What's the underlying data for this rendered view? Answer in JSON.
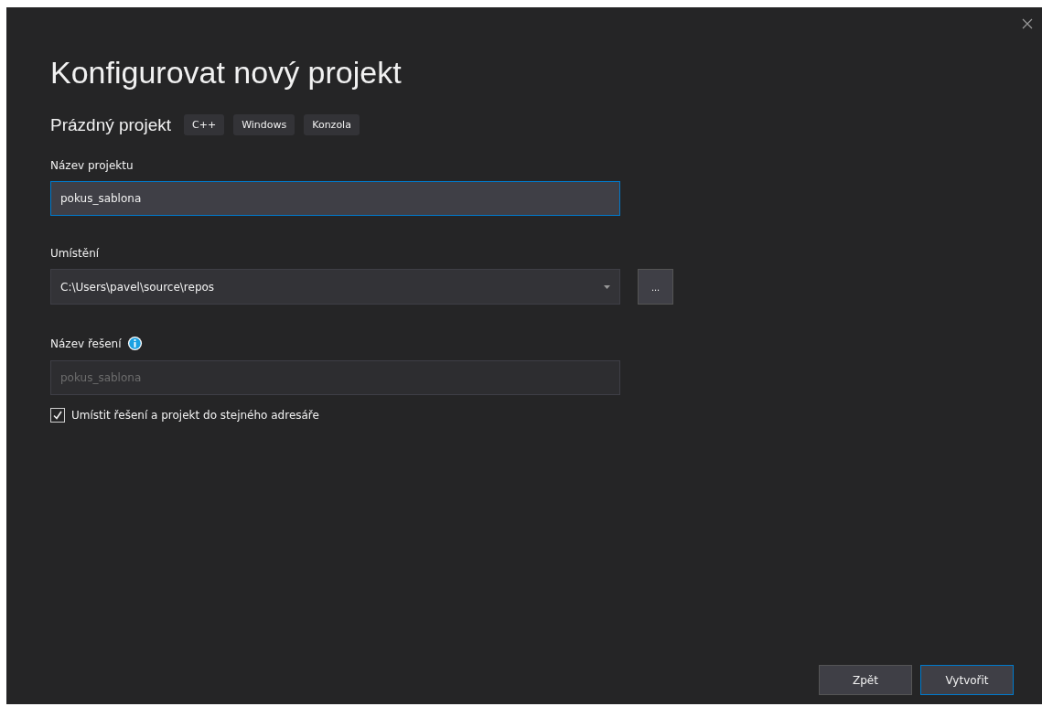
{
  "window": {
    "title": "Konfigurovat nový projekt"
  },
  "template": {
    "name": "Prázdný projekt",
    "tags": [
      "C++",
      "Windows",
      "Konzola"
    ]
  },
  "fields": [
    {
      "kind": "text",
      "label": "Název projektu",
      "value": "pokus_sablona",
      "focused": true
    },
    {
      "kind": "dropdown",
      "label": "Umístění",
      "value": "C:\\Users\\pavel\\source\\repos",
      "browse": "..."
    },
    {
      "kind": "text",
      "label": "Název řešení",
      "info": true,
      "placeholder": "pokus_sablona",
      "disabled": true
    }
  ],
  "checkbox": {
    "label": "Umístit řešení a projekt do stejného adresáře",
    "checked": true
  },
  "buttons": [
    {
      "label": "Zpět",
      "selected": false
    },
    {
      "label": "Vytvořit",
      "selected": true
    }
  ]
}
